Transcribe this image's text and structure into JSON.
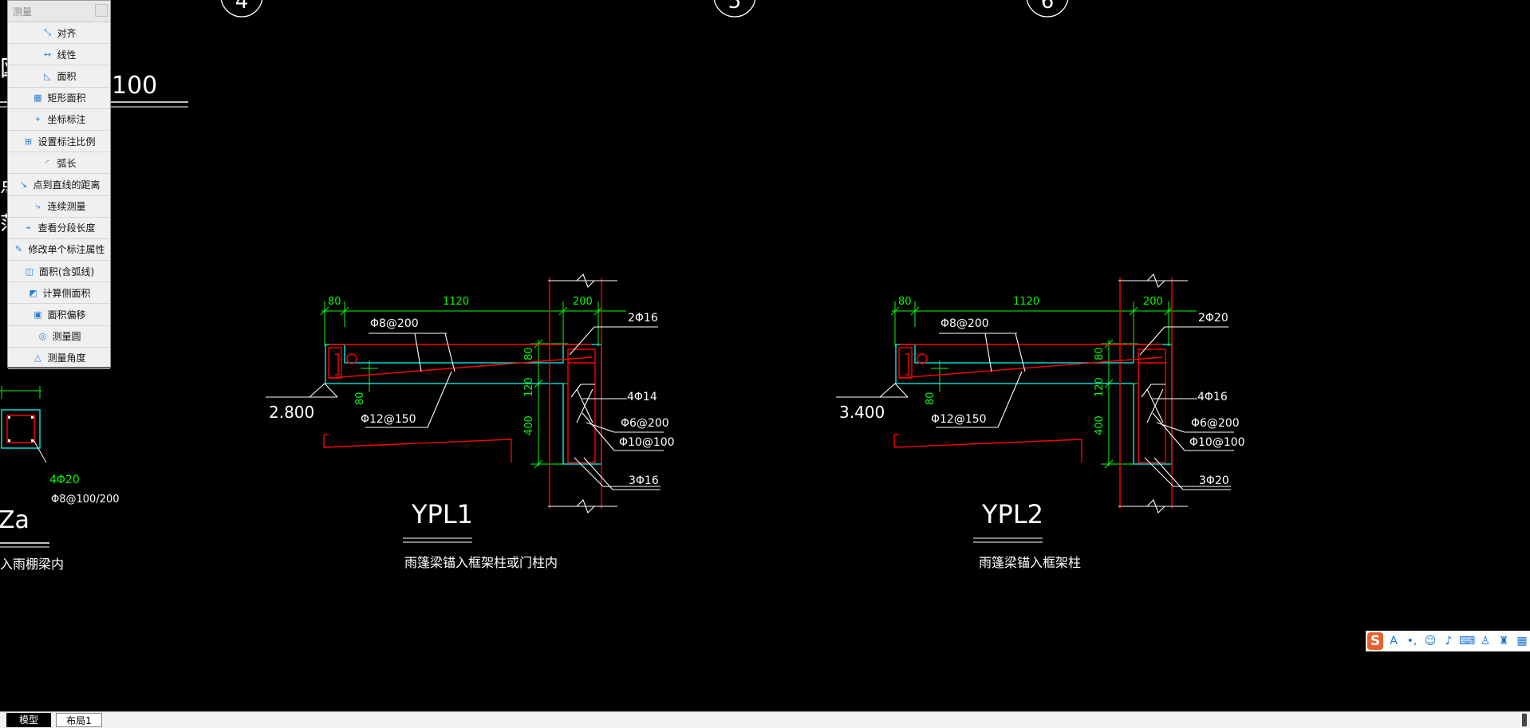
{
  "palette": {
    "title": "测量",
    "items": [
      {
        "icon": "align-measure-icon",
        "glyph": "⤡",
        "label": "对齐"
      },
      {
        "icon": "linear-measure-icon",
        "glyph": "↔",
        "label": "线性"
      },
      {
        "icon": "area-icon",
        "glyph": "◺",
        "label": "面积"
      },
      {
        "icon": "rect-area-icon",
        "glyph": "▦",
        "label": "矩形面积"
      },
      {
        "icon": "coordinate-icon",
        "glyph": "⌖",
        "label": "坐标标注"
      },
      {
        "icon": "scale-setting-icon",
        "glyph": "⊞",
        "label": "设置标注比例"
      },
      {
        "icon": "arc-length-icon",
        "glyph": "◜",
        "label": "弧长"
      },
      {
        "icon": "point-line-distance-icon",
        "glyph": "↘",
        "label": "点到直线的距离"
      },
      {
        "icon": "continuous-measure-icon",
        "glyph": "⤷",
        "label": "连续测量"
      },
      {
        "icon": "segment-length-icon",
        "glyph": "⌁",
        "label": "查看分段长度"
      },
      {
        "icon": "edit-dim-icon",
        "glyph": "✎",
        "label": "修改单个标注属性"
      },
      {
        "icon": "arc-area-icon",
        "glyph": "◫",
        "label": "面积(含弧线)"
      },
      {
        "icon": "side-area-icon",
        "glyph": "◩",
        "label": "计算侧面积"
      },
      {
        "icon": "area-offset-icon",
        "glyph": "▣",
        "label": "面积偏移"
      },
      {
        "icon": "measure-circle-icon",
        "glyph": "◎",
        "label": "测量圆"
      },
      {
        "icon": "measure-angle-icon",
        "glyph": "△",
        "label": "测量角度"
      }
    ]
  },
  "drawing": {
    "axis_bubbles": [
      "4",
      "5",
      "6"
    ],
    "left_partial": {
      "scale_text": "100",
      "col_rebar": "4Φ20",
      "stirrup": "Φ8@100/200",
      "col_name": "Za",
      "note": "入雨棚梁内"
    },
    "detail1": {
      "title": "YPL1",
      "caption": "雨篷梁锚入框架柱或门柱内",
      "dim_80": "80",
      "dim_1120": "1120",
      "dim_200": "200",
      "top_bar": "2Φ16",
      "slab_bar": "Φ8@200",
      "dist_bar": "Φ12@150",
      "elevation": "2.800",
      "side_bar": "4Φ14",
      "stirrup_a": "Φ6@200",
      "stirrup_b": "Φ10@100",
      "bot_bar": "3Φ16",
      "v80": "80",
      "v120": "120",
      "v400": "400",
      "v80b": "80"
    },
    "detail2": {
      "title": "YPL2",
      "caption": "雨篷梁锚入框架柱",
      "dim_80": "80",
      "dim_1120": "1120",
      "dim_200": "200",
      "top_bar": "2Φ20",
      "slab_bar": "Φ8@200",
      "dist_bar": "Φ12@150",
      "elevation": "3.400",
      "side_bar": "4Φ16",
      "stirrup_a": "Φ6@200",
      "stirrup_b": "Φ10@100",
      "bot_bar": "3Φ20",
      "v80": "80",
      "v120": "120",
      "v400": "400",
      "v80b": "80"
    }
  },
  "layout_tabs": {
    "model": "模型",
    "layout1": "布局1"
  },
  "ime": {
    "logo": "S",
    "buttons": [
      {
        "icon": "font-icon",
        "glyph": "A"
      },
      {
        "icon": "punct-icon",
        "glyph": "•,"
      },
      {
        "icon": "emoji-icon",
        "glyph": "☺"
      },
      {
        "icon": "mic-icon",
        "glyph": "♪"
      },
      {
        "icon": "keyboard-icon",
        "glyph": "⌨"
      },
      {
        "icon": "user-icon",
        "glyph": "♙"
      },
      {
        "icon": "skin-icon",
        "glyph": "♜"
      },
      {
        "icon": "grid-icon",
        "glyph": "▦"
      }
    ]
  },
  "colors": {
    "background": "#000000",
    "white": "#ffffff",
    "red": "#ff0000",
    "green": "#00ff00",
    "cyan": "#00ffff"
  }
}
